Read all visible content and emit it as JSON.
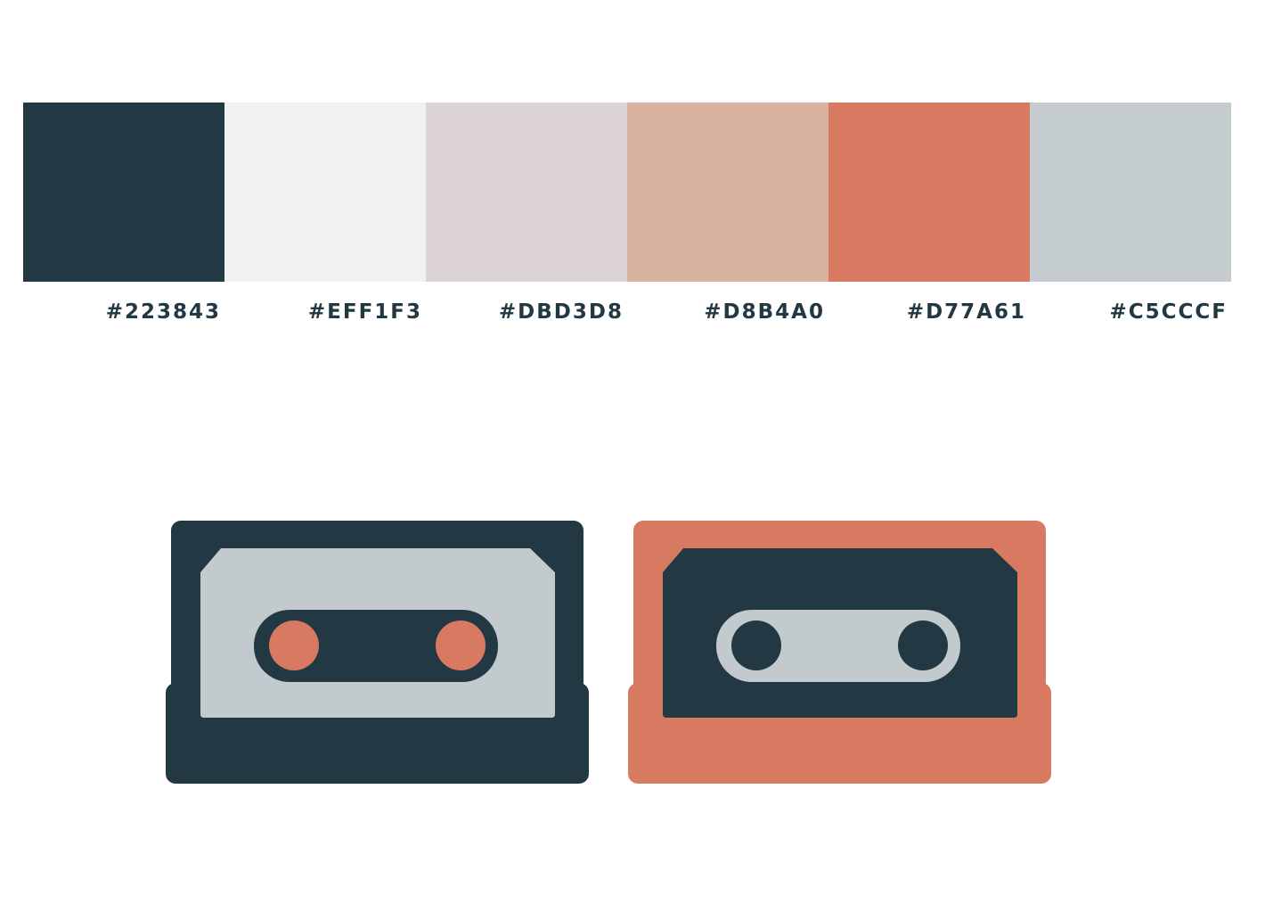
{
  "palette": [
    {
      "hex": "#223843",
      "label": "#223843"
    },
    {
      "hex": "#EFF1F3",
      "label": "#EFF1F3"
    },
    {
      "hex": "#DBD3D8",
      "label": "#DBD3D8"
    },
    {
      "hex": "#D8B4A0",
      "label": "#D8B4A0"
    },
    {
      "hex": "#D77A61",
      "label": "#D77A61"
    },
    {
      "hex": "#C5CCCF",
      "label": "#C5CCCF"
    }
  ],
  "cassettes": [
    {
      "body": "#223843",
      "label": "#C3CACD",
      "window": "#223843",
      "reels": "#D77A61"
    },
    {
      "body": "#D77A61",
      "label": "#223843",
      "window": "#C3CACD",
      "reels": "#223843"
    }
  ]
}
